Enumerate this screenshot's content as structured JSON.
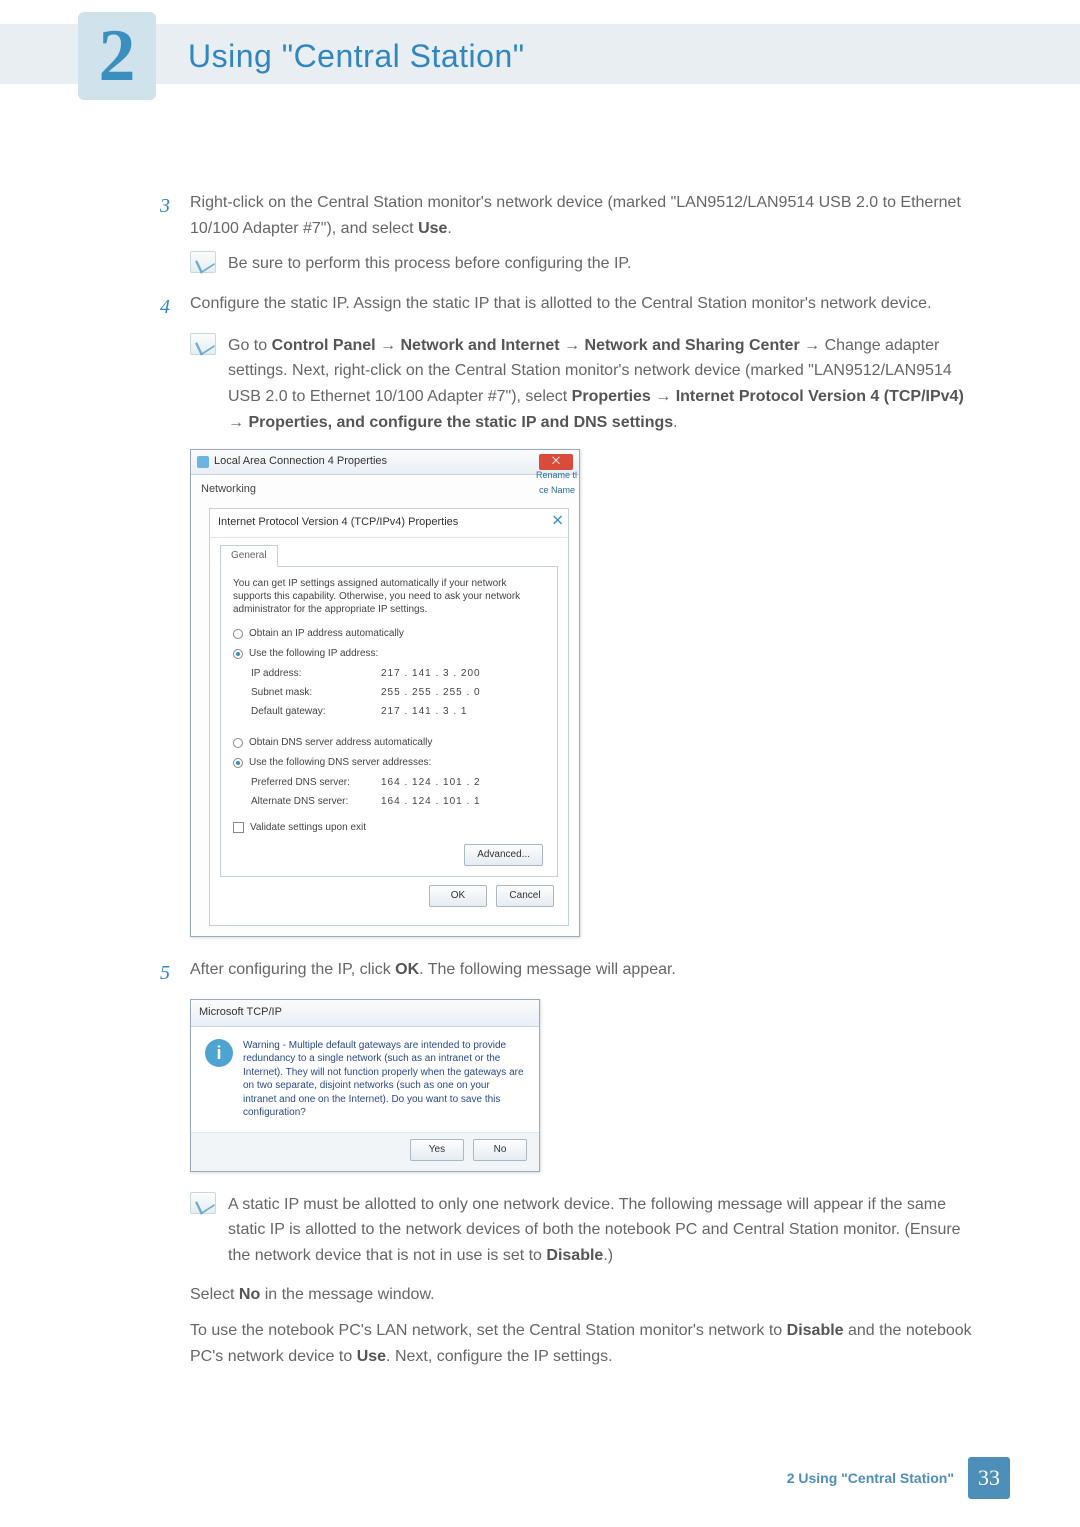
{
  "header": {
    "chapter_number": "2",
    "chapter_title": "Using \"Central Station\""
  },
  "steps": {
    "s3": {
      "num": "3",
      "text_a": "Right-click on the Central Station monitor's network device (marked \"LAN9512/LAN9514 USB 2.0 to Ethernet 10/100 Adapter #7\"), and select ",
      "bold_use": "Use",
      "period": "."
    },
    "s3_note": "Be sure to perform this process before configuring the IP.",
    "s4": {
      "num": "4",
      "text": "Configure the static IP. Assign the static IP that is allotted to the Central Station monitor's network device."
    },
    "s4_note": {
      "p1a": "Go to ",
      "cp": "Control Panel",
      "arr": " → ",
      "ni": " Network and Internet",
      "nsc": " Network and Sharing Center",
      "chg": " Change adapter settings. Next, right-click on the Central Station monitor's network device (marked \"LAN9512/LAN9514 USB 2.0 to Ethernet 10/100 Adapter #7\"), select ",
      "prop": "Properties",
      "ipv4": " Internet Protocol Version 4 (TCP/IPv4)",
      "last": " Properties, and configure the static IP and DNS settings",
      "dot": "."
    },
    "s5": {
      "num": "5",
      "text_a": "After configuring the IP, click ",
      "ok": "OK",
      "text_b": ". The following message will appear."
    },
    "bottom_note": "A static IP must be allotted to only one network device. The following message will appear if the same static IP is allotted to the network devices of both the notebook PC and Central Station monitor. (Ensure the network device that is not in use is set to ",
    "bottom_note_bold": "Disable",
    "bottom_note_end": ".)",
    "after1_a": "Select ",
    "after1_bold": "No",
    "after1_b": " in the message window.",
    "after2_a": "To use the notebook PC's LAN network, set the Central Station monitor's network to ",
    "after2_bold1": "Disable",
    "after2_b": " and the notebook PC's network device to ",
    "after2_bold2": "Use",
    "after2_c": ". Next, configure the IP settings."
  },
  "dialog1": {
    "outer_title": "Local Area Connection 4 Properties",
    "tab_networking": "Networking",
    "rename": "Rename tl",
    "ce_name": "ce Name",
    "inner_title": "Internet Protocol Version 4 (TCP/IPv4) Properties",
    "close_x": "⨉",
    "tab_general": "General",
    "desc": "You can get IP settings assigned automatically if your network supports this capability. Otherwise, you need to ask your network administrator for the appropriate IP settings.",
    "r1": "Obtain an IP address automatically",
    "r2": "Use the following IP address:",
    "ip_label": "IP address:",
    "ip_value": "217 . 141 .  3  . 200",
    "mask_label": "Subnet mask:",
    "mask_value": "255 . 255 . 255 .  0",
    "gw_label": "Default gateway:",
    "gw_value": "217 . 141 .  3  .  1",
    "r3": "Obtain DNS server address automatically",
    "r4": "Use the following DNS server addresses:",
    "pdns_label": "Preferred DNS server:",
    "pdns_value": "164 . 124 . 101 .  2",
    "adns_label": "Alternate DNS server:",
    "adns_value": "164 . 124 . 101 .  1",
    "validate": "Validate settings upon exit",
    "advanced": "Advanced...",
    "ok": "OK",
    "cancel": "Cancel"
  },
  "dialog2": {
    "title": "Microsoft TCP/IP",
    "icon": "i",
    "text": "Warning - Multiple default gateways are intended to provide redundancy to a single network (such as an intranet or the Internet). They will not function properly when the gateways are on two separate, disjoint networks (such as one on your intranet and one on the Internet). Do you want to save this configuration?",
    "yes": "Yes",
    "no": "No"
  },
  "footer": {
    "text": "2 Using \"Central Station\"",
    "page": "33"
  }
}
